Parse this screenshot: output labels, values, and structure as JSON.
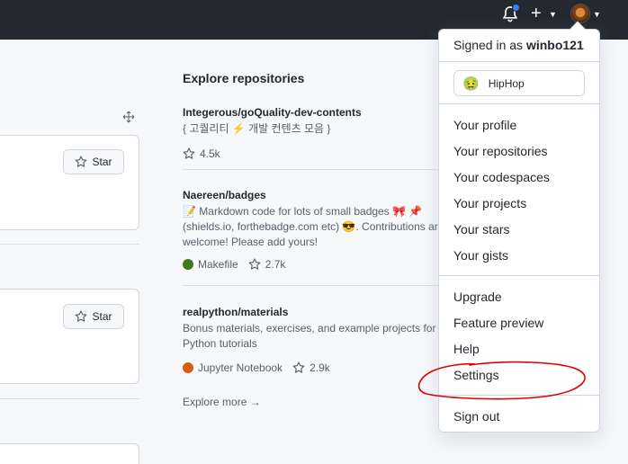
{
  "header": {
    "notifications_icon": "bell-icon",
    "new_icon": "plus-icon",
    "avatar_icon": "avatar"
  },
  "left": {
    "star_label": "Star"
  },
  "explore": {
    "title": "Explore repositories",
    "repos": [
      {
        "name": "Integerous/goQuality-dev-contents",
        "description_lines": [
          "{ 고퀄리티 ⚡ 개발 컨텐츠 모음 }"
        ],
        "language": "",
        "language_color": "",
        "stars": "4.5k"
      },
      {
        "name": "Naereen/badges",
        "description_lines": [
          "📝 Markdown code for lots of small badges 🎀 📌",
          "(shields.io, forthebadge.com etc) 😎. Contributions are",
          "welcome! Please add yours!"
        ],
        "language": "Makefile",
        "language_color": "#427819",
        "stars": "2.7k"
      },
      {
        "name": "realpython/materials",
        "description_lines": [
          "Bonus materials, exercises, and example projects for our",
          "Python tutorials"
        ],
        "language": "Jupyter Notebook",
        "language_color": "#DA5B0B",
        "stars": "2.9k"
      }
    ],
    "more": "Explore more →"
  },
  "menu": {
    "signed_prefix": "Signed in as",
    "username": "winbo121",
    "status_emoji": "🤢",
    "status_text": "HipHop",
    "items_group1": [
      "Your profile",
      "Your repositories",
      "Your codespaces",
      "Your projects",
      "Your stars",
      "Your gists"
    ],
    "items_group2": [
      "Upgrade",
      "Feature preview",
      "Help",
      "Settings"
    ],
    "sign_out": "Sign out"
  },
  "colors": {
    "header_bg": "#24292f",
    "page_bg": "#f6f8fa",
    "notification_dot": "#2f81f7",
    "annotation": "#e00000"
  }
}
